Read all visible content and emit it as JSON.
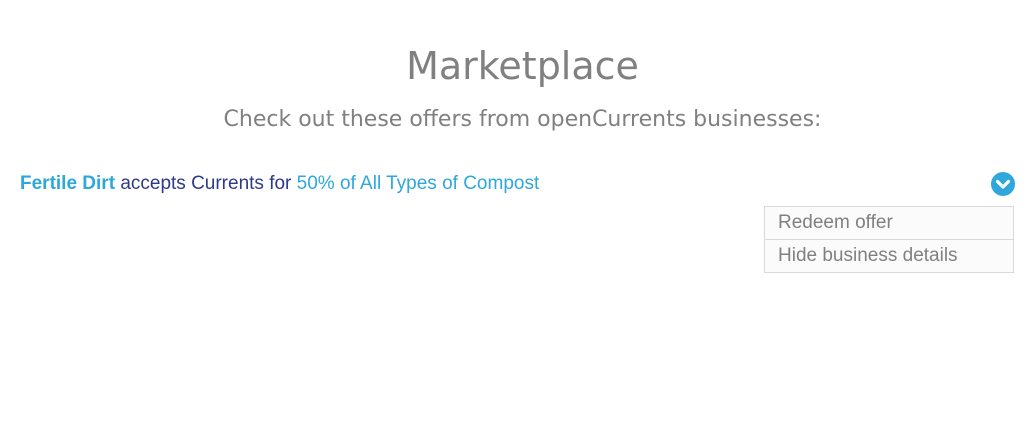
{
  "header": {
    "title": "Marketplace",
    "subtitle": "Check out these offers from openCurrents businesses:"
  },
  "offers": [
    {
      "business_name": "Fertile Dirt",
      "connector_text": "accepts Currents for",
      "offer_text": "50% of All Types of Compost",
      "toggle_icon": "chevron-down-circle-icon",
      "menu": {
        "items": [
          {
            "label": "Redeem offer"
          },
          {
            "label": "Hide business details"
          }
        ]
      }
    }
  ],
  "colors": {
    "accent": "#2ea8db",
    "connector_text": "#2e3a87",
    "muted_text": "#808080",
    "menu_border": "#d9d9d9",
    "background": "#ffffff"
  }
}
